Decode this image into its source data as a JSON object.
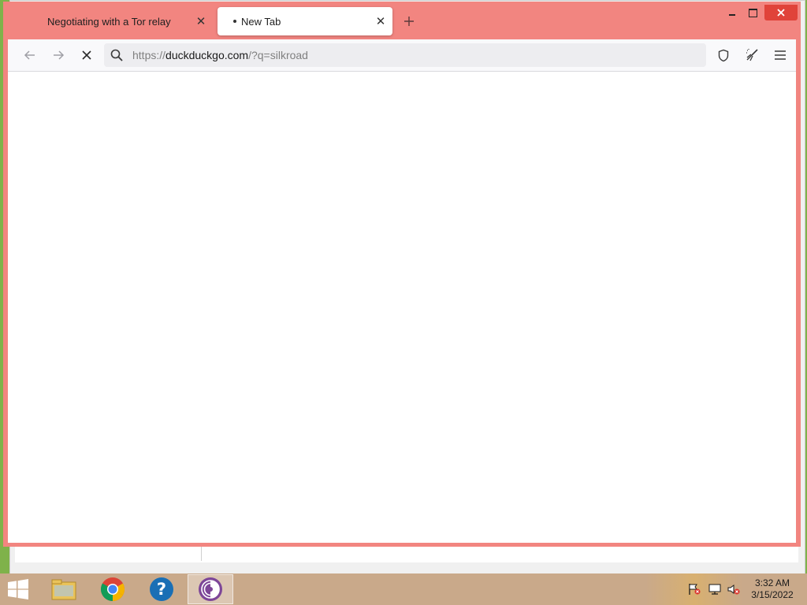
{
  "browser": {
    "tabs": [
      {
        "label": "Negotiating with a Tor relay",
        "active": false
      },
      {
        "label": "New Tab",
        "active": true,
        "loading": true
      }
    ],
    "url": {
      "scheme": "https://",
      "host": "duckduckgo.com",
      "path": "/?q=silkroad"
    },
    "icons": {
      "back": "arrow-left-icon",
      "forward": "arrow-right-icon",
      "reload": "stop-icon",
      "search": "search-icon",
      "shield": "shield-icon",
      "new_identity": "broom-icon",
      "menu": "hamburger-icon"
    }
  },
  "taskbar": {
    "apps": [
      "file-explorer",
      "chrome",
      "help",
      "tor-browser"
    ],
    "clock": {
      "time": "3:32 AM",
      "date": "3/15/2022"
    }
  },
  "colors": {
    "private_frame": "#f28580",
    "close_button": "#e0433a",
    "toolbar": "#f9f9fb",
    "urlbar": "#ededf0"
  }
}
